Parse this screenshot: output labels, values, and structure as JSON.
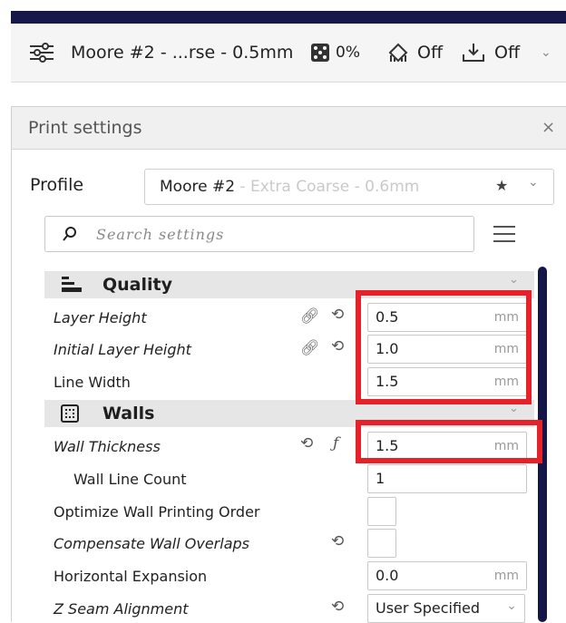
{
  "header": {
    "profile_summary": "Moore #2 - ...rse - 0.5mm",
    "infill_value": "0%",
    "support_value": "Off",
    "adhesion_value": "Off"
  },
  "panel": {
    "title": "Print settings",
    "close_glyph": "×",
    "profile_label": "Profile",
    "profile_name": "Moore #2",
    "profile_sub": " - Extra Coarse - 0.6mm",
    "search_placeholder": "Search settings"
  },
  "categories": {
    "quality": "Quality",
    "walls": "Walls"
  },
  "settings": {
    "layer_height": {
      "label": "Layer Height",
      "value": "0.5",
      "unit": "mm"
    },
    "initial_layer_height": {
      "label": "Initial Layer Height",
      "value": "1.0",
      "unit": "mm"
    },
    "line_width": {
      "label": "Line Width",
      "value": "1.5",
      "unit": "mm"
    },
    "wall_thickness": {
      "label": "Wall Thickness",
      "value": "1.5",
      "unit": "mm"
    },
    "wall_line_count": {
      "label": "Wall Line Count",
      "value": "1"
    },
    "optimize_wall_order": {
      "label": "Optimize Wall Printing Order"
    },
    "compensate_wall_overlaps": {
      "label": "Compensate Wall Overlaps"
    },
    "horizontal_expansion": {
      "label": "Horizontal Expansion",
      "value": "0.0",
      "unit": "mm"
    },
    "z_seam_alignment": {
      "label": "Z Seam Alignment",
      "value": "User Specified"
    }
  },
  "colors": {
    "highlight_red": "#e62129",
    "scrollbar_navy": "#14164a",
    "topbar_navy": "#16184a"
  }
}
